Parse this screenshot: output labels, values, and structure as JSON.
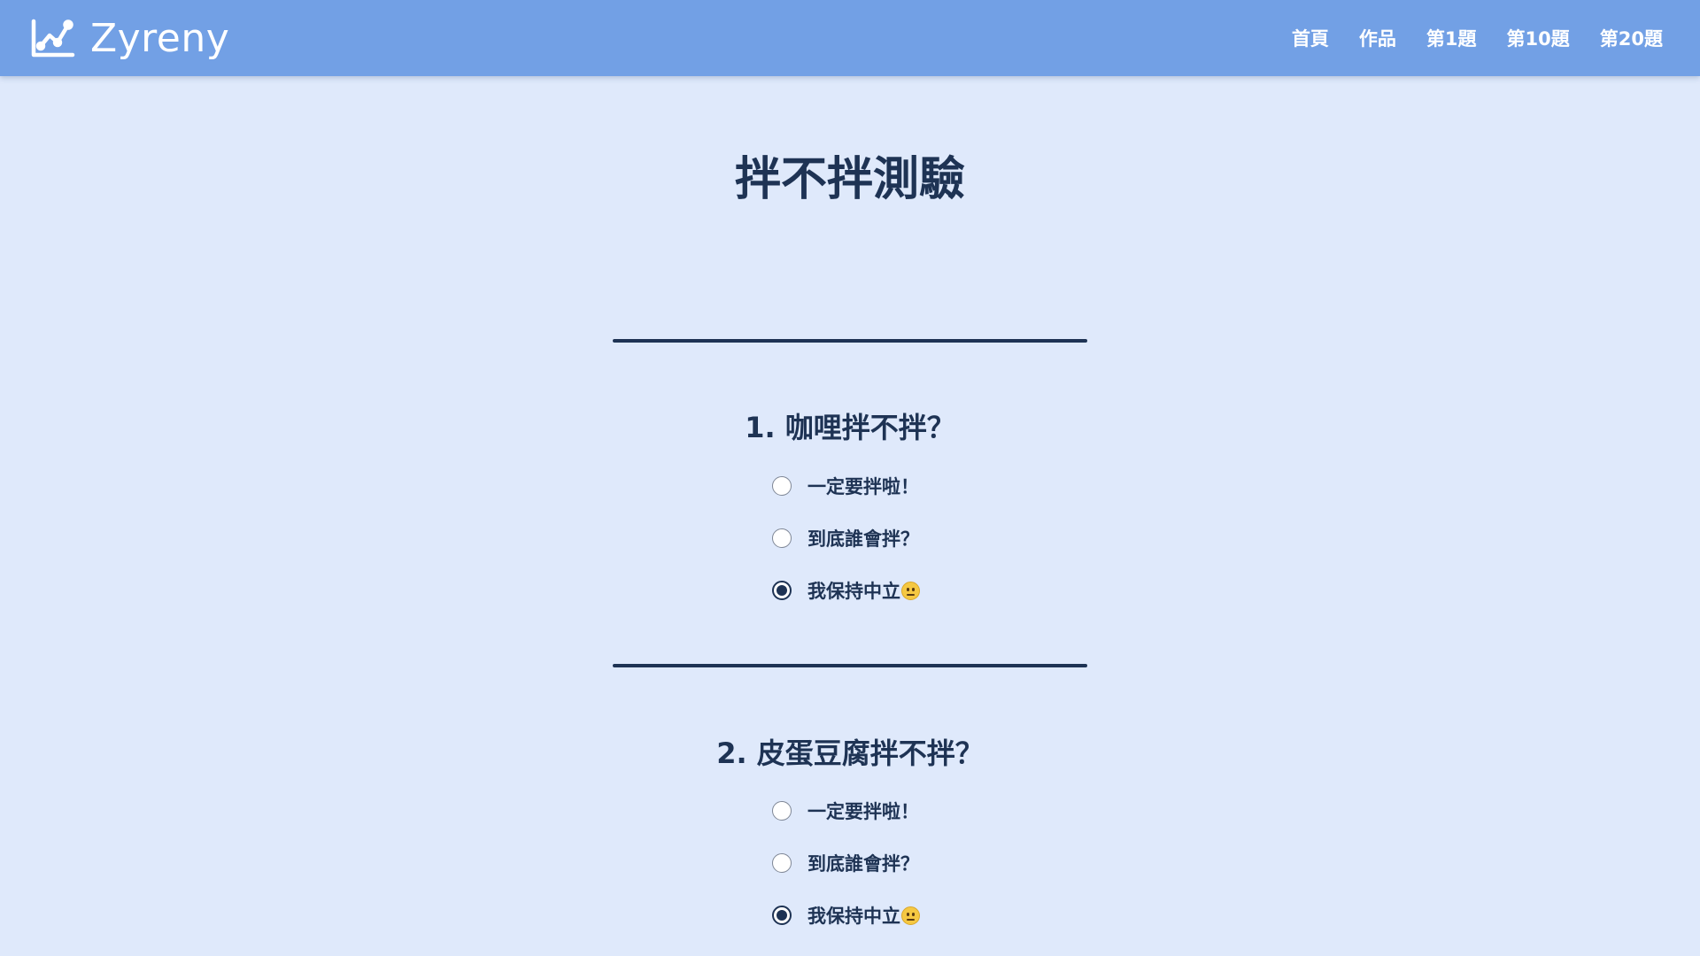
{
  "navbar": {
    "brand": "Zyreny",
    "links": [
      "首頁",
      "作品",
      "第1題",
      "第10題",
      "第20題"
    ]
  },
  "page": {
    "title": "拌不拌測驗"
  },
  "questions": [
    {
      "title": "1. 咖哩拌不拌？",
      "options": [
        {
          "label": "一定要拌啦！",
          "checked": false
        },
        {
          "label": "到底誰會拌？",
          "checked": false
        },
        {
          "label": "我保持中立",
          "checked": true,
          "emoji": "neutral-face-emoji"
        }
      ]
    },
    {
      "title": "2. 皮蛋豆腐拌不拌？",
      "options": [
        {
          "label": "一定要拌啦！",
          "checked": false
        },
        {
          "label": "到底誰會拌？",
          "checked": false
        },
        {
          "label": "我保持中立",
          "checked": true,
          "emoji": "neutral-face-emoji"
        }
      ]
    }
  ],
  "colors": {
    "navbar": "#72a0e5",
    "background": "#dfe9fb",
    "text": "#1e3354"
  }
}
